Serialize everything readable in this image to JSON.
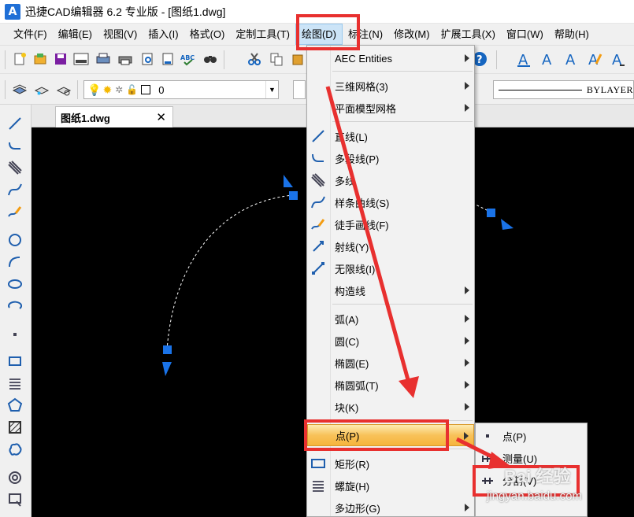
{
  "window": {
    "app_logo": "A",
    "title": "迅捷CAD编辑器 6.2 专业版  - [图纸1.dwg]"
  },
  "menubar": {
    "items": [
      {
        "label": "文件(F)"
      },
      {
        "label": "编辑(E)"
      },
      {
        "label": "视图(V)"
      },
      {
        "label": "插入(I)"
      },
      {
        "label": "格式(O)"
      },
      {
        "label": "定制工具(T)"
      },
      {
        "label": "绘图(D)"
      },
      {
        "label": "标注(N)"
      },
      {
        "label": "修改(M)"
      },
      {
        "label": "扩展工具(X)"
      },
      {
        "label": "窗口(W)"
      },
      {
        "label": "帮助(H)"
      }
    ]
  },
  "toolbar2": {
    "layer_value": "0",
    "linetype_value": "BYLAYER"
  },
  "tabs": [
    {
      "label": "图纸1.dwg",
      "close": "✕"
    }
  ],
  "draw_menu": {
    "items": [
      {
        "label": "AEC Entities",
        "submenu": true
      },
      {
        "label": "三维网格(3)",
        "submenu": true
      },
      {
        "label": "平面模型网格",
        "submenu": true
      },
      {
        "label": "直线(L)",
        "submenu": false
      },
      {
        "label": "多段线(P)",
        "submenu": false
      },
      {
        "label": "多线",
        "submenu": false
      },
      {
        "label": "样条曲线(S)",
        "submenu": false
      },
      {
        "label": "徒手画线(F)",
        "submenu": false
      },
      {
        "label": "射线(Y)",
        "submenu": false
      },
      {
        "label": "无限线(I)",
        "submenu": false
      },
      {
        "label": "构造线",
        "submenu": true
      },
      {
        "label": "弧(A)",
        "submenu": true
      },
      {
        "label": "圆(C)",
        "submenu": true
      },
      {
        "label": "椭圆(E)",
        "submenu": true
      },
      {
        "label": "椭圆弧(T)",
        "submenu": true
      },
      {
        "label": "块(K)",
        "submenu": true
      },
      {
        "label": "点(P)",
        "submenu": true
      },
      {
        "label": "矩形(R)",
        "submenu": false
      },
      {
        "label": "螺旋(H)",
        "submenu": false
      },
      {
        "label": "多边形(G)",
        "submenu": true
      }
    ]
  },
  "point_submenu": {
    "items": [
      {
        "label": "点(P)"
      },
      {
        "label": "测量(U)"
      },
      {
        "label": "分割(V)"
      }
    ]
  },
  "watermark": {
    "brand": "Bai 经验",
    "url": "jingyan.baidu.com"
  },
  "colors": {
    "annotation_red": "#e8302f",
    "highlight_orange": "#f8c25a",
    "grip_blue": "#1a73e8",
    "canvas_bg": "#000000"
  }
}
